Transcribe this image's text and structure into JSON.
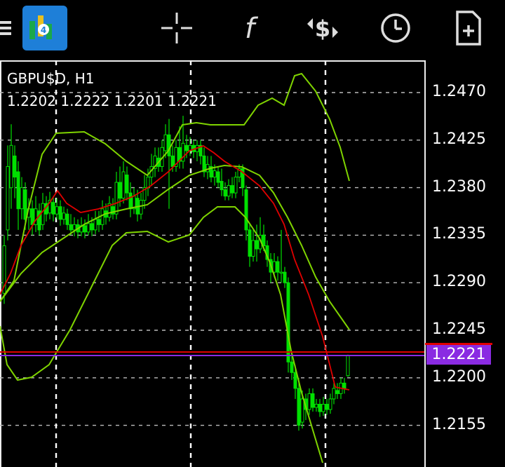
{
  "toolbar": {
    "menu_icon": "hamburger-menu-icon",
    "app_icon": "metatrader-logo-icon",
    "crosshair_icon": "crosshair-icon",
    "indicators_icon": "function-f-icon",
    "trade_icon": "trade-dollar-arrows-icon",
    "timeframe_icon": "clock-icon",
    "new_order_icon": "add-document-icon"
  },
  "chart": {
    "symbol_timeframe": "GBPU$D, H1",
    "ohlc": "1.2202 1.2222 1.2201 1.2221",
    "current_price": "1.2221",
    "colors": {
      "bull": "#00e000",
      "bear": "#00e000",
      "bands": "#7fd400",
      "ma": "#e00000",
      "bid_line": "#e00000",
      "ask_line": "#8a2be2",
      "badge": "#8a2be2"
    }
  },
  "chart_data": {
    "type": "candlestick",
    "y_ticks": [
      "1.2470",
      "1.2425",
      "1.2380",
      "1.2335",
      "1.2290",
      "1.2245",
      "1.2200",
      "1.2155"
    ],
    "ylim": [
      1.2125,
      1.25
    ],
    "grid": true,
    "indicators": [
      "Bollinger Bands",
      "Moving Average"
    ]
  }
}
